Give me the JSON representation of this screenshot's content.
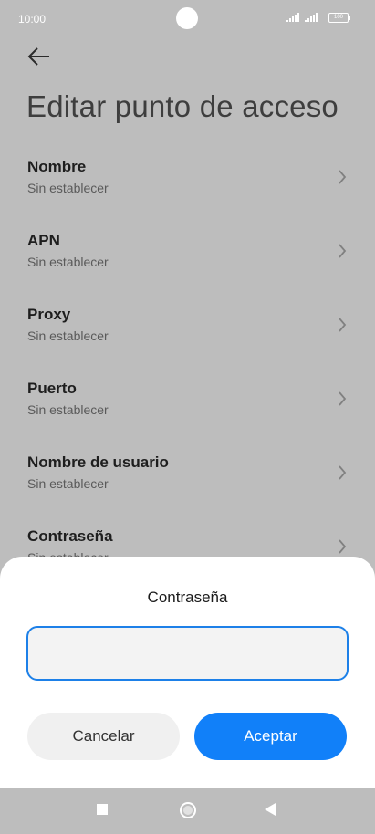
{
  "status_bar": {
    "time": "10:00",
    "battery": "100"
  },
  "header": {
    "title": "Editar punto de acceso"
  },
  "list": {
    "items": [
      {
        "title": "Nombre",
        "value": "Sin establecer"
      },
      {
        "title": "APN",
        "value": "Sin establecer"
      },
      {
        "title": "Proxy",
        "value": "Sin establecer"
      },
      {
        "title": "Puerto",
        "value": "Sin establecer"
      },
      {
        "title": "Nombre de usuario",
        "value": "Sin establecer"
      },
      {
        "title": "Contraseña",
        "value": "Sin establecer"
      }
    ]
  },
  "dialog": {
    "title": "Contraseña",
    "input_value": "",
    "cancel_label": "Cancelar",
    "accept_label": "Aceptar"
  },
  "colors": {
    "accent": "#1180f9",
    "overlay": "#bdbdbd"
  },
  "icons": {
    "back": "arrow-left-icon",
    "chevron": "chevron-right-icon"
  }
}
